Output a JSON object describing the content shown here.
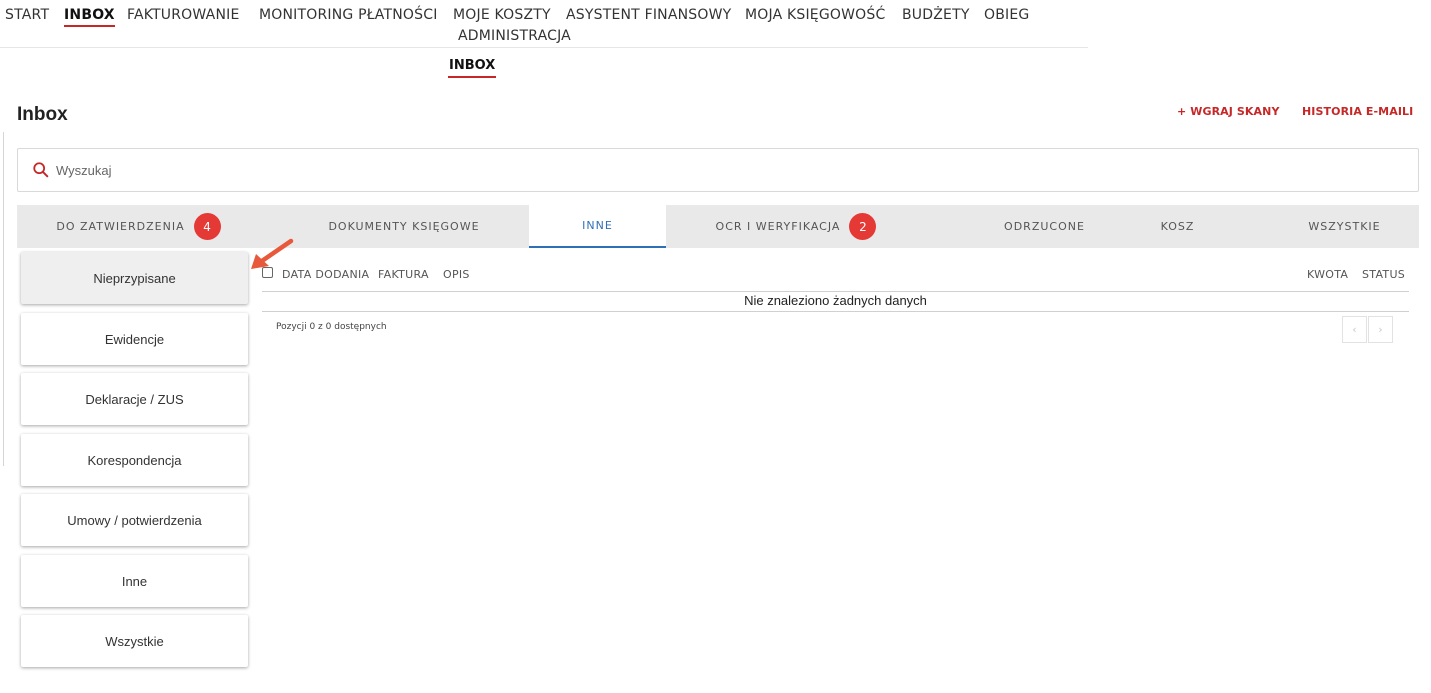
{
  "topnav": {
    "items": [
      "START",
      "INBOX",
      "FAKTUROWANIE",
      "MONITORING PŁATNOŚCI",
      "MOJE KOSZTY",
      "ASYSTENT FINANSOWY",
      "MOJA KSIĘGOWOŚĆ",
      "BUDŻETY",
      "OBIEG",
      "ADMINISTRACJA"
    ],
    "active": "INBOX"
  },
  "subnav": {
    "active": "INBOX"
  },
  "page": {
    "title": "Inbox"
  },
  "actions": {
    "upload": "+ WGRAJ SKANY",
    "email_history": "HISTORIA E-MAILI"
  },
  "search": {
    "placeholder": "Wyszukaj",
    "value": ""
  },
  "tabs": [
    {
      "label": "DO ZATWIERDZENIA",
      "badge": "4"
    },
    {
      "label": "DOKUMENTY KSIĘGOWE"
    },
    {
      "label": "INNE",
      "active": true
    },
    {
      "label": "OCR I WERYFIKACJA",
      "badge": "2"
    },
    {
      "label": "ODRZUCONE"
    },
    {
      "label": "KOSZ"
    },
    {
      "label": "WSZYSTKIE"
    }
  ],
  "categories": [
    "Nieprzypisane",
    "Ewidencje",
    "Deklaracje / ZUS",
    "Korespondencja",
    "Umowy / potwierdzenia",
    "Inne",
    "Wszystkie"
  ],
  "table": {
    "columns": [
      "DATA DODANIA",
      "FAKTURA",
      "OPIS",
      "KWOTA",
      "STATUS"
    ],
    "empty_message": "Nie znaleziono żadnych danych",
    "pager_info": "Pozycji 0 z 0 dostępnych",
    "prev": "‹",
    "next": "›"
  },
  "colors": {
    "accent": "#c62828",
    "active_tab": "#2f6fb5",
    "badge": "#e53935",
    "arrow": "#e8583a"
  }
}
